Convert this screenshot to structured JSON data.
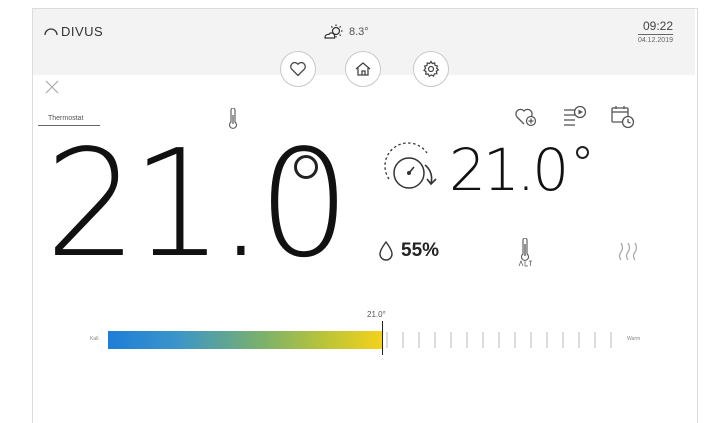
{
  "header": {
    "brand": "DIVUS",
    "outdoor_temp": "8.3°",
    "time": "09:22",
    "date": "04.12.2019"
  },
  "nav": [
    "favorites-button",
    "home-button",
    "settings-button"
  ],
  "panel": {
    "tab_label": "Thermostat",
    "current_temp": "21.0",
    "set_temp": "21.0",
    "humidity": "55%"
  },
  "slider": {
    "value_label": "21.0°",
    "left_label": "Kalt",
    "right_label": "Warm",
    "fill_fraction": 0.53
  },
  "colors": {
    "cold": "#1e7ed8",
    "warm": "#f3d21a",
    "accent": "#222222"
  }
}
